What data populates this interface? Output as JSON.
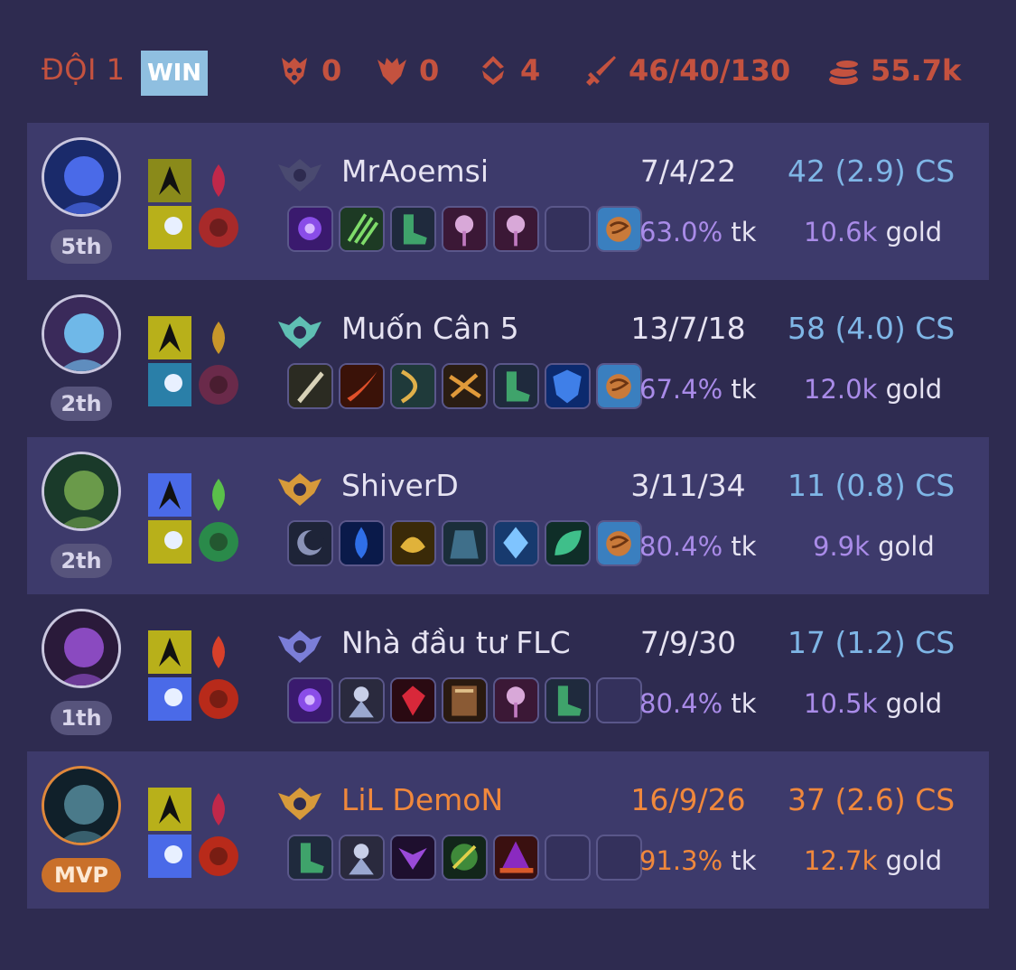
{
  "header": {
    "team_label": "ĐỘI 1",
    "result_badge": "WIN",
    "towers": "0",
    "barons": "0",
    "dragons": "4",
    "kda_total": "46/40/130",
    "gold_total": "55.7k",
    "accent_color": "#c4523f",
    "badge_color": "#8fbfe0"
  },
  "players": [
    {
      "name": "MrAoemsi",
      "kda": "7/4/22",
      "cs": "42 (2.9) CS",
      "kill_participation": "63.0%",
      "kp_unit": "tk",
      "gold": "10.6k",
      "gold_unit": "gold",
      "rank_label": "5th",
      "highlight": true,
      "mvp": false,
      "rank_emblem_color": "#4a4a70",
      "items": [
        "item-purple-orb-icon",
        "item-claw-icon",
        "item-boots-icon",
        "item-staff-icon",
        "item-staff-icon",
        "empty",
        "item-cookie-icon"
      ]
    },
    {
      "name": "Muốn Cân 5",
      "kda": "13/7/18",
      "cs": "58 (4.0) CS",
      "kill_participation": "67.4%",
      "kp_unit": "tk",
      "gold": "12.0k",
      "gold_unit": "gold",
      "rank_label": "2th",
      "highlight": false,
      "mvp": false,
      "rank_emblem_color": "#5fbfb3",
      "items": [
        "item-sword-icon",
        "item-blade-icon",
        "item-bow-icon",
        "item-crossbow-icon",
        "item-boots-icon",
        "item-shield-icon",
        "item-cookie-icon"
      ]
    },
    {
      "name": "ShiverD",
      "kda": "3/11/34",
      "cs": "11 (0.8) CS",
      "kill_participation": "80.4%",
      "kp_unit": "tk",
      "gold": "9.9k",
      "gold_unit": "gold",
      "rank_label": "2th",
      "highlight": true,
      "mvp": false,
      "rank_emblem_color": "#d79a3a",
      "items": [
        "item-moon-icon",
        "item-drop-icon",
        "item-gold-icon",
        "item-cloak-icon",
        "item-crystal-icon",
        "item-leaf-icon",
        "item-cookie-icon"
      ]
    },
    {
      "name": "Nhà đầu tư FLC",
      "kda": "7/9/30",
      "cs": "17 (1.2) CS",
      "kill_participation": "80.4%",
      "kp_unit": "tk",
      "gold": "10.5k",
      "gold_unit": "gold",
      "rank_label": "1th",
      "highlight": false,
      "mvp": false,
      "rank_emblem_color": "#7b7ed8",
      "items": [
        "item-purple-orb-icon",
        "item-mage-icon",
        "item-ruby-icon",
        "item-book-icon",
        "item-staff-icon",
        "item-boots-icon",
        "empty"
      ]
    },
    {
      "name": "LiL DemoN",
      "kda": "16/9/26",
      "cs": "37 (2.6) CS",
      "kill_participation": "91.3%",
      "kp_unit": "tk",
      "gold": "12.7k",
      "gold_unit": "gold",
      "rank_label": "MVP",
      "highlight": true,
      "mvp": true,
      "rank_emblem_color": "#d79a3a",
      "items": [
        "item-boots-icon",
        "item-mage-icon",
        "item-mask-icon",
        "item-orb-green-icon",
        "item-hat-icon",
        "empty",
        "empty"
      ]
    }
  ]
}
